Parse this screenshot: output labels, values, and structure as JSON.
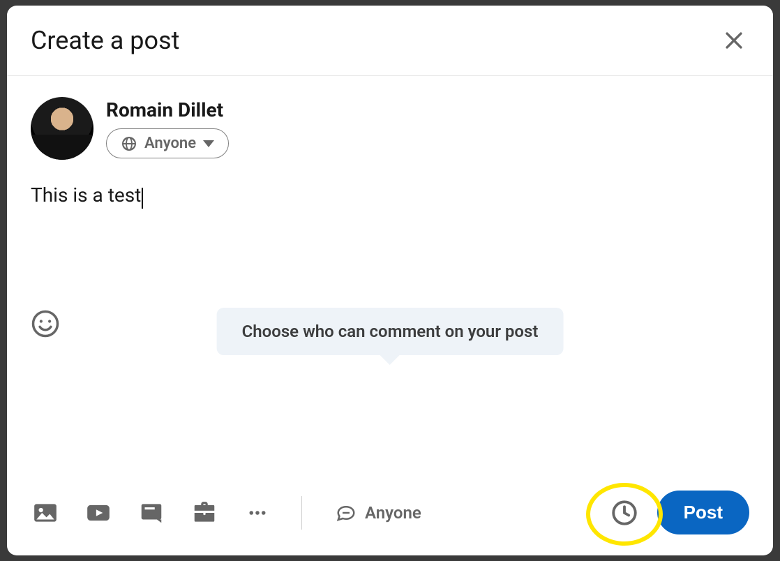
{
  "header": {
    "title": "Create a post"
  },
  "author": {
    "name": "Romain Dillet",
    "visibility_label": "Anyone"
  },
  "post": {
    "body": "This is a test"
  },
  "tooltip": "Choose who can comment on your post",
  "footer": {
    "comment_visibility": "Anyone",
    "post_button": "Post"
  },
  "icons": {
    "close": "close-icon",
    "globe": "globe-icon",
    "emoji": "emoji-icon",
    "photo": "photo-icon",
    "video": "video-icon",
    "document": "document-icon",
    "job": "briefcase-icon",
    "more": "more-icon",
    "message": "message-icon",
    "schedule": "clock-icon"
  }
}
